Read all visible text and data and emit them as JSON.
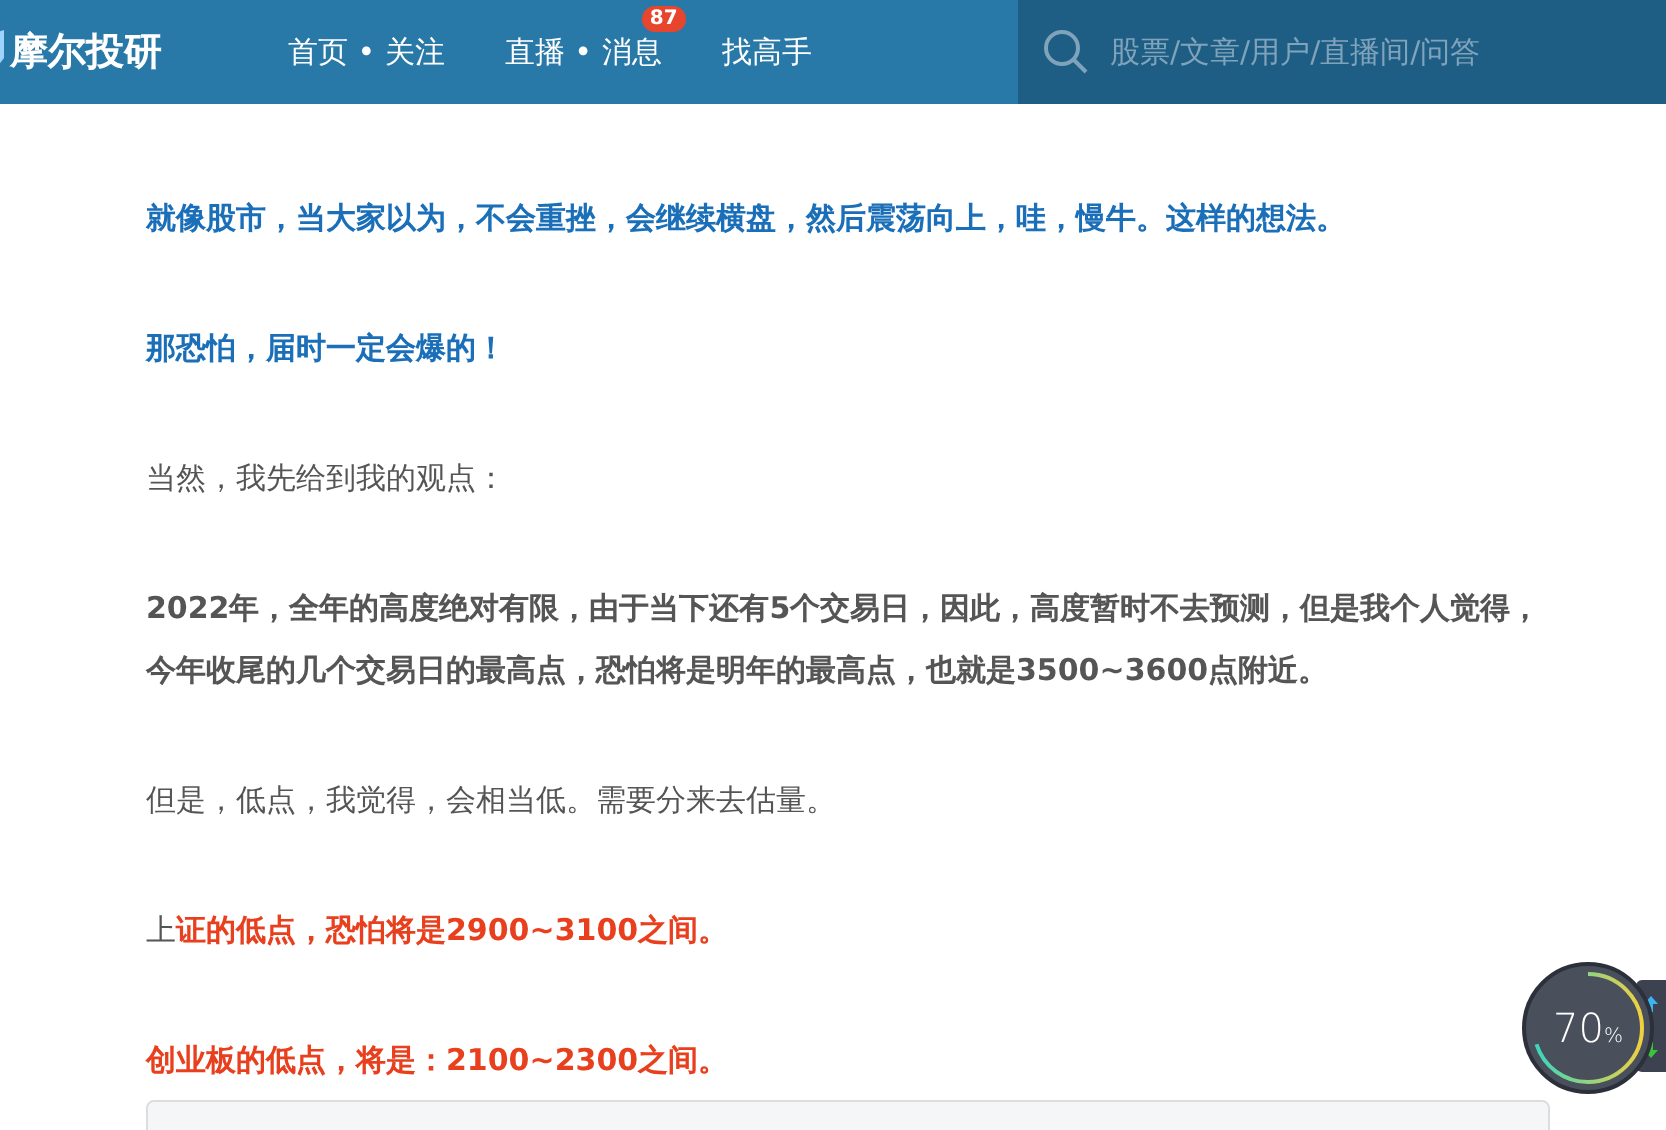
{
  "header": {
    "logo": "摩尔投研",
    "nav": [
      {
        "label": "首页 • 关注"
      },
      {
        "label": "直播 • 消息",
        "badge": "87"
      },
      {
        "label": "找高手"
      }
    ],
    "search": {
      "placeholder": "股票/文章/用户/直播间/问答"
    }
  },
  "paragraphs": [
    {
      "segments": [
        {
          "kind": "blue",
          "text": "就像股市，当大家以为，不会重挫，会继续横盘，然后震荡向上，哇，慢牛。这样的想法。"
        }
      ]
    },
    {
      "segments": [
        {
          "kind": "blue",
          "text": "那恐怕，届时一定会爆的！"
        }
      ]
    },
    {
      "segments": [
        {
          "kind": "plain",
          "text": "当然，我先给到我的观点："
        }
      ]
    },
    {
      "segments": [
        {
          "kind": "bold",
          "text": "2022年，全年的高度绝对有限，由于当下还有5个交易日，因此，高度暂时不去预测，但是我个人觉得，今年收尾的几个交易日的最高点，恐怕将是明年的最高点，也就是3500~3600点附近。"
        }
      ]
    },
    {
      "segments": [
        {
          "kind": "plain",
          "text": "但是，低点，我觉得，会相当低。需要分来去估量。"
        }
      ]
    },
    {
      "segments": [
        {
          "kind": "plain",
          "text": "上"
        },
        {
          "kind": "red",
          "text": "证的低点，恐怕将是2900~3100之间。"
        }
      ]
    },
    {
      "segments": [
        {
          "kind": "red",
          "text": "创业板的低点，将是：2100~2300之间。"
        }
      ]
    }
  ],
  "widget": {
    "reading": "70",
    "unit": "%"
  }
}
